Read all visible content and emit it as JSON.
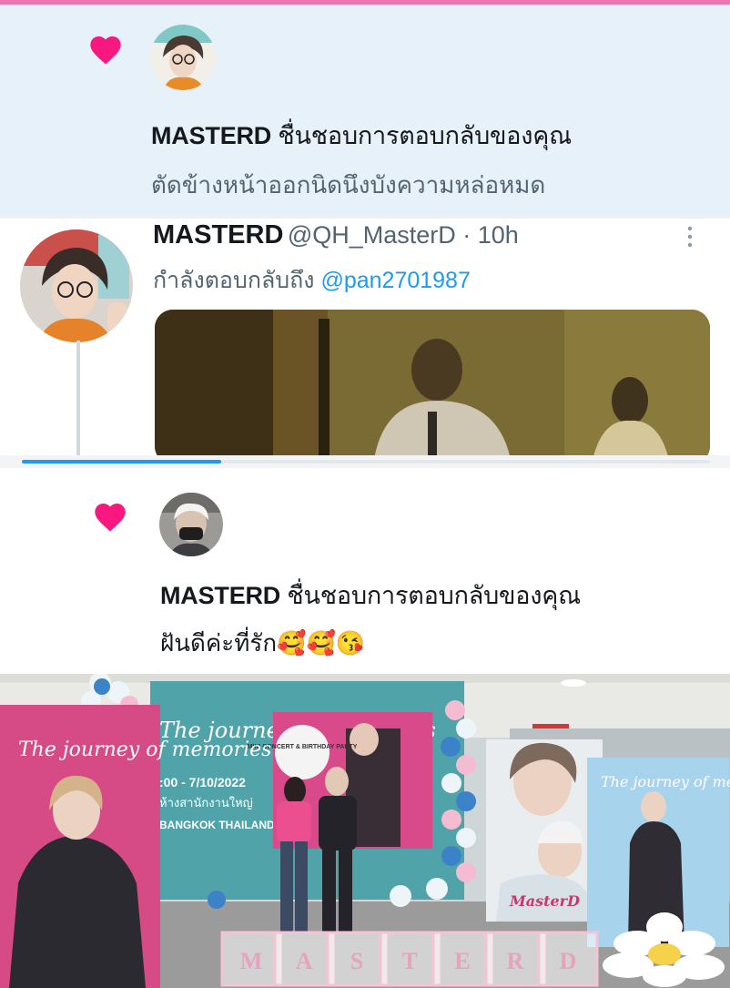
{
  "notification_1": {
    "icon": "heart-icon",
    "user": "MASTERD",
    "action": "ชื่นชอบการตอบกลับของคุณ",
    "reply_text": "ตัดข้างหน้าออกนิดนึงบังความหล่อหมด"
  },
  "tweet": {
    "display_name": "MASTERD",
    "handle_time": "@QH_MasterD · 10h",
    "replying_prefix": "กำลังตอบกลับถึง",
    "replying_to": "@pan2701987",
    "more_icon": "more-vertical-icon",
    "video_progress": 0.29
  },
  "notification_2": {
    "icon": "heart-icon",
    "user": "MASTERD",
    "action": "ชื่นชอบการตอบกลับของคุณ",
    "reply_text": "ฝันดีค่ะที่รัก🥰🥰😘"
  },
  "photo": {
    "banner_left": "The journey of memories",
    "banner_center_title": "The journey of memories",
    "banner_center_date": ":00 - 7/10/2022",
    "banner_center_venue": "ห้างสานักงานใหญ่",
    "banner_center_city": "BANGKOK THAILAND",
    "banner_right": "The journey of memories",
    "banner_mid_logo": "MasterD",
    "sign_text": "MINI CONCERT & BIRTHDAY PARTY",
    "boxes": [
      "M",
      "A",
      "S",
      "T",
      "E",
      "R",
      "D"
    ]
  },
  "colors": {
    "heart": "#f91880",
    "link": "#1d9bf0",
    "secondary_text": "#536471",
    "notification_bg": "#e6f1fa",
    "top_accent": "#ea78b0"
  }
}
